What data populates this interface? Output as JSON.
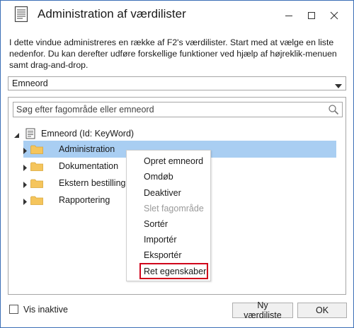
{
  "window": {
    "title": "Administration af værdilister",
    "description": "I dette vindue administreres en række af F2's værdilister. Start med at vælge en liste nedenfor. Du kan derefter udføre forskellige funktioner ved hjælp af højreklik-menuen samt drag-and-drop."
  },
  "list_select": {
    "value": "Emneord"
  },
  "search": {
    "placeholder": "Søg efter fagområde eller emneord"
  },
  "tree": {
    "root_label": "Emneord (Id: KeyWord)",
    "items": [
      {
        "label": "Administration",
        "selected": true
      },
      {
        "label": "Dokumentation",
        "selected": false
      },
      {
        "label": "Ekstern bestilling",
        "selected": false
      },
      {
        "label": "Rapportering",
        "selected": false
      }
    ]
  },
  "context_menu": {
    "items": [
      {
        "label": "Opret emneord",
        "enabled": true
      },
      {
        "label": "Omdøb",
        "enabled": true
      },
      {
        "label": "Deaktiver",
        "enabled": true
      },
      {
        "label": "Slet fagområde",
        "enabled": false
      },
      {
        "label": "Sortér",
        "enabled": true
      },
      {
        "label": "Importér",
        "enabled": true
      },
      {
        "label": "Eksportér",
        "enabled": true
      },
      {
        "label": "Ret egenskaber",
        "enabled": true,
        "highlighted": true
      }
    ]
  },
  "footer": {
    "show_inactive_label": "Vis inaktive",
    "show_inactive_checked": false,
    "new_list_button": "Ny værdiliste",
    "ok_button": "OK"
  },
  "colors": {
    "selection": "#a9cef2",
    "folder": "#f5c55c",
    "highlight_border": "#d0021b",
    "window_border": "#3c6fb6"
  }
}
